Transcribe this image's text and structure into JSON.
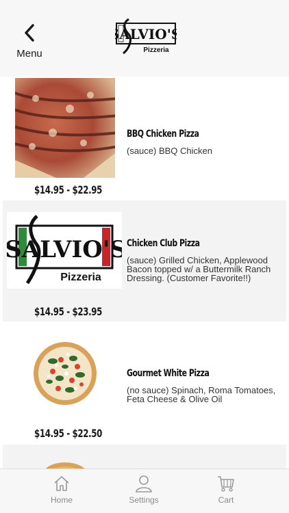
{
  "header": {
    "back_label": "Menu",
    "logo_text": "SALVIO'S",
    "logo_subtext": "Pizzeria"
  },
  "items": [
    {
      "name": "BBQ Chicken Pizza",
      "description": "(sauce) BBQ Chicken",
      "price": "$14.95 - $22.95"
    },
    {
      "name": "Chicken Club Pizza",
      "description": "(sauce) Grilled Chicken, Applewood Bacon topped w/ a Buttermilk Ranch Dressing. (Customer Favorite!!)",
      "price": "$14.95 - $23.95"
    },
    {
      "name": "Gourmet White Pizza",
      "description": "(no sauce) Spinach, Roma Tomatoes, Feta Cheese & Olive Oil",
      "price": "$14.95 - $22.50"
    }
  ],
  "tabs": [
    {
      "label": "Home",
      "icon": "home-icon"
    },
    {
      "label": "Settings",
      "icon": "user-icon"
    },
    {
      "label": "Cart",
      "icon": "cart-icon"
    }
  ],
  "colors": {
    "logo_green": "#2e8b3c",
    "logo_red": "#c8242b",
    "header_bg": "#f7f7f7",
    "shaded_row": "#f3f3f3"
  }
}
